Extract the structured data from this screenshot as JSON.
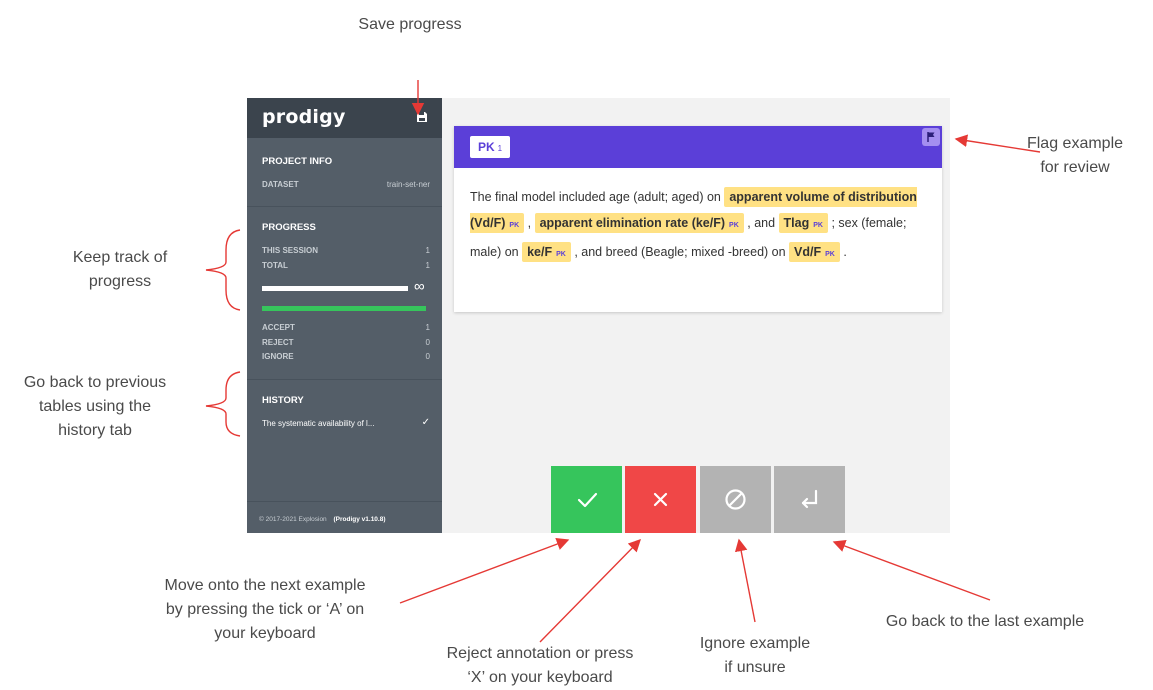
{
  "annotations": {
    "save": "Save progress",
    "flag": [
      "Flag example",
      "for review"
    ],
    "progress": [
      "Keep track of",
      "progress"
    ],
    "history": [
      "Go back to previous",
      "tables using the",
      "history tab"
    ],
    "accept": [
      "Move onto the next example",
      "by pressing the tick or ‘A’ on",
      "your keyboard"
    ],
    "reject": [
      "Reject annotation or press",
      "‘X’ on your keyboard"
    ],
    "ignore": [
      "Ignore example",
      "if unsure"
    ],
    "undo": "Go back to the last example"
  },
  "sidebar": {
    "brand": "prodigy",
    "project_info": {
      "title": "PROJECT INFO",
      "dataset_key": "DATASET",
      "dataset_value": "train-set-ner"
    },
    "progress": {
      "title": "PROGRESS",
      "this_session_key": "THIS SESSION",
      "this_session_value": "1",
      "total_key": "TOTAL",
      "total_value": "1",
      "infinity": "∞",
      "green_fraction": 1.0
    },
    "counts": {
      "accept_key": "ACCEPT",
      "accept_value": "1",
      "reject_key": "REJECT",
      "reject_value": "0",
      "ignore_key": "IGNORE",
      "ignore_value": "0"
    },
    "history": {
      "title": "HISTORY",
      "item": "The systematic availability of l...",
      "item_mark": "✓"
    },
    "footer": {
      "copyright": "© 2017-2021 Explosion",
      "version": "(Prodigy v1.10.8)"
    }
  },
  "card": {
    "label": "PK",
    "label_key": "1",
    "text_segments": [
      {
        "t": "The final model included age (adult; aged) on "
      },
      {
        "t": "apparent volume of distribution (Vd/F)",
        "ent": "PK"
      },
      {
        "t": " , "
      },
      {
        "t": "apparent elimination rate (ke/F)",
        "ent": "PK"
      },
      {
        "t": " , and "
      },
      {
        "t": "Tlag",
        "ent": "PK"
      },
      {
        "t": " ; sex (female; male) on "
      },
      {
        "t": "ke/F",
        "ent": "PK"
      },
      {
        "t": " , and breed (Beagle; mixed -breed) on "
      },
      {
        "t": "Vd/F",
        "ent": "PK"
      },
      {
        "t": " ."
      }
    ]
  },
  "colors": {
    "accept": "#36c55c",
    "reject": "#f04747",
    "ignore": "#b3b3b3",
    "undo": "#b3b3b3",
    "header": "#5b3fd8",
    "entity": "#ffe184",
    "arrow": "#e53935"
  },
  "icons": {
    "accept": "check-icon",
    "reject": "x-icon",
    "ignore": "ban-icon",
    "undo": "return-arrow-icon",
    "save": "floppy-disk-icon",
    "flag": "flag-icon"
  }
}
